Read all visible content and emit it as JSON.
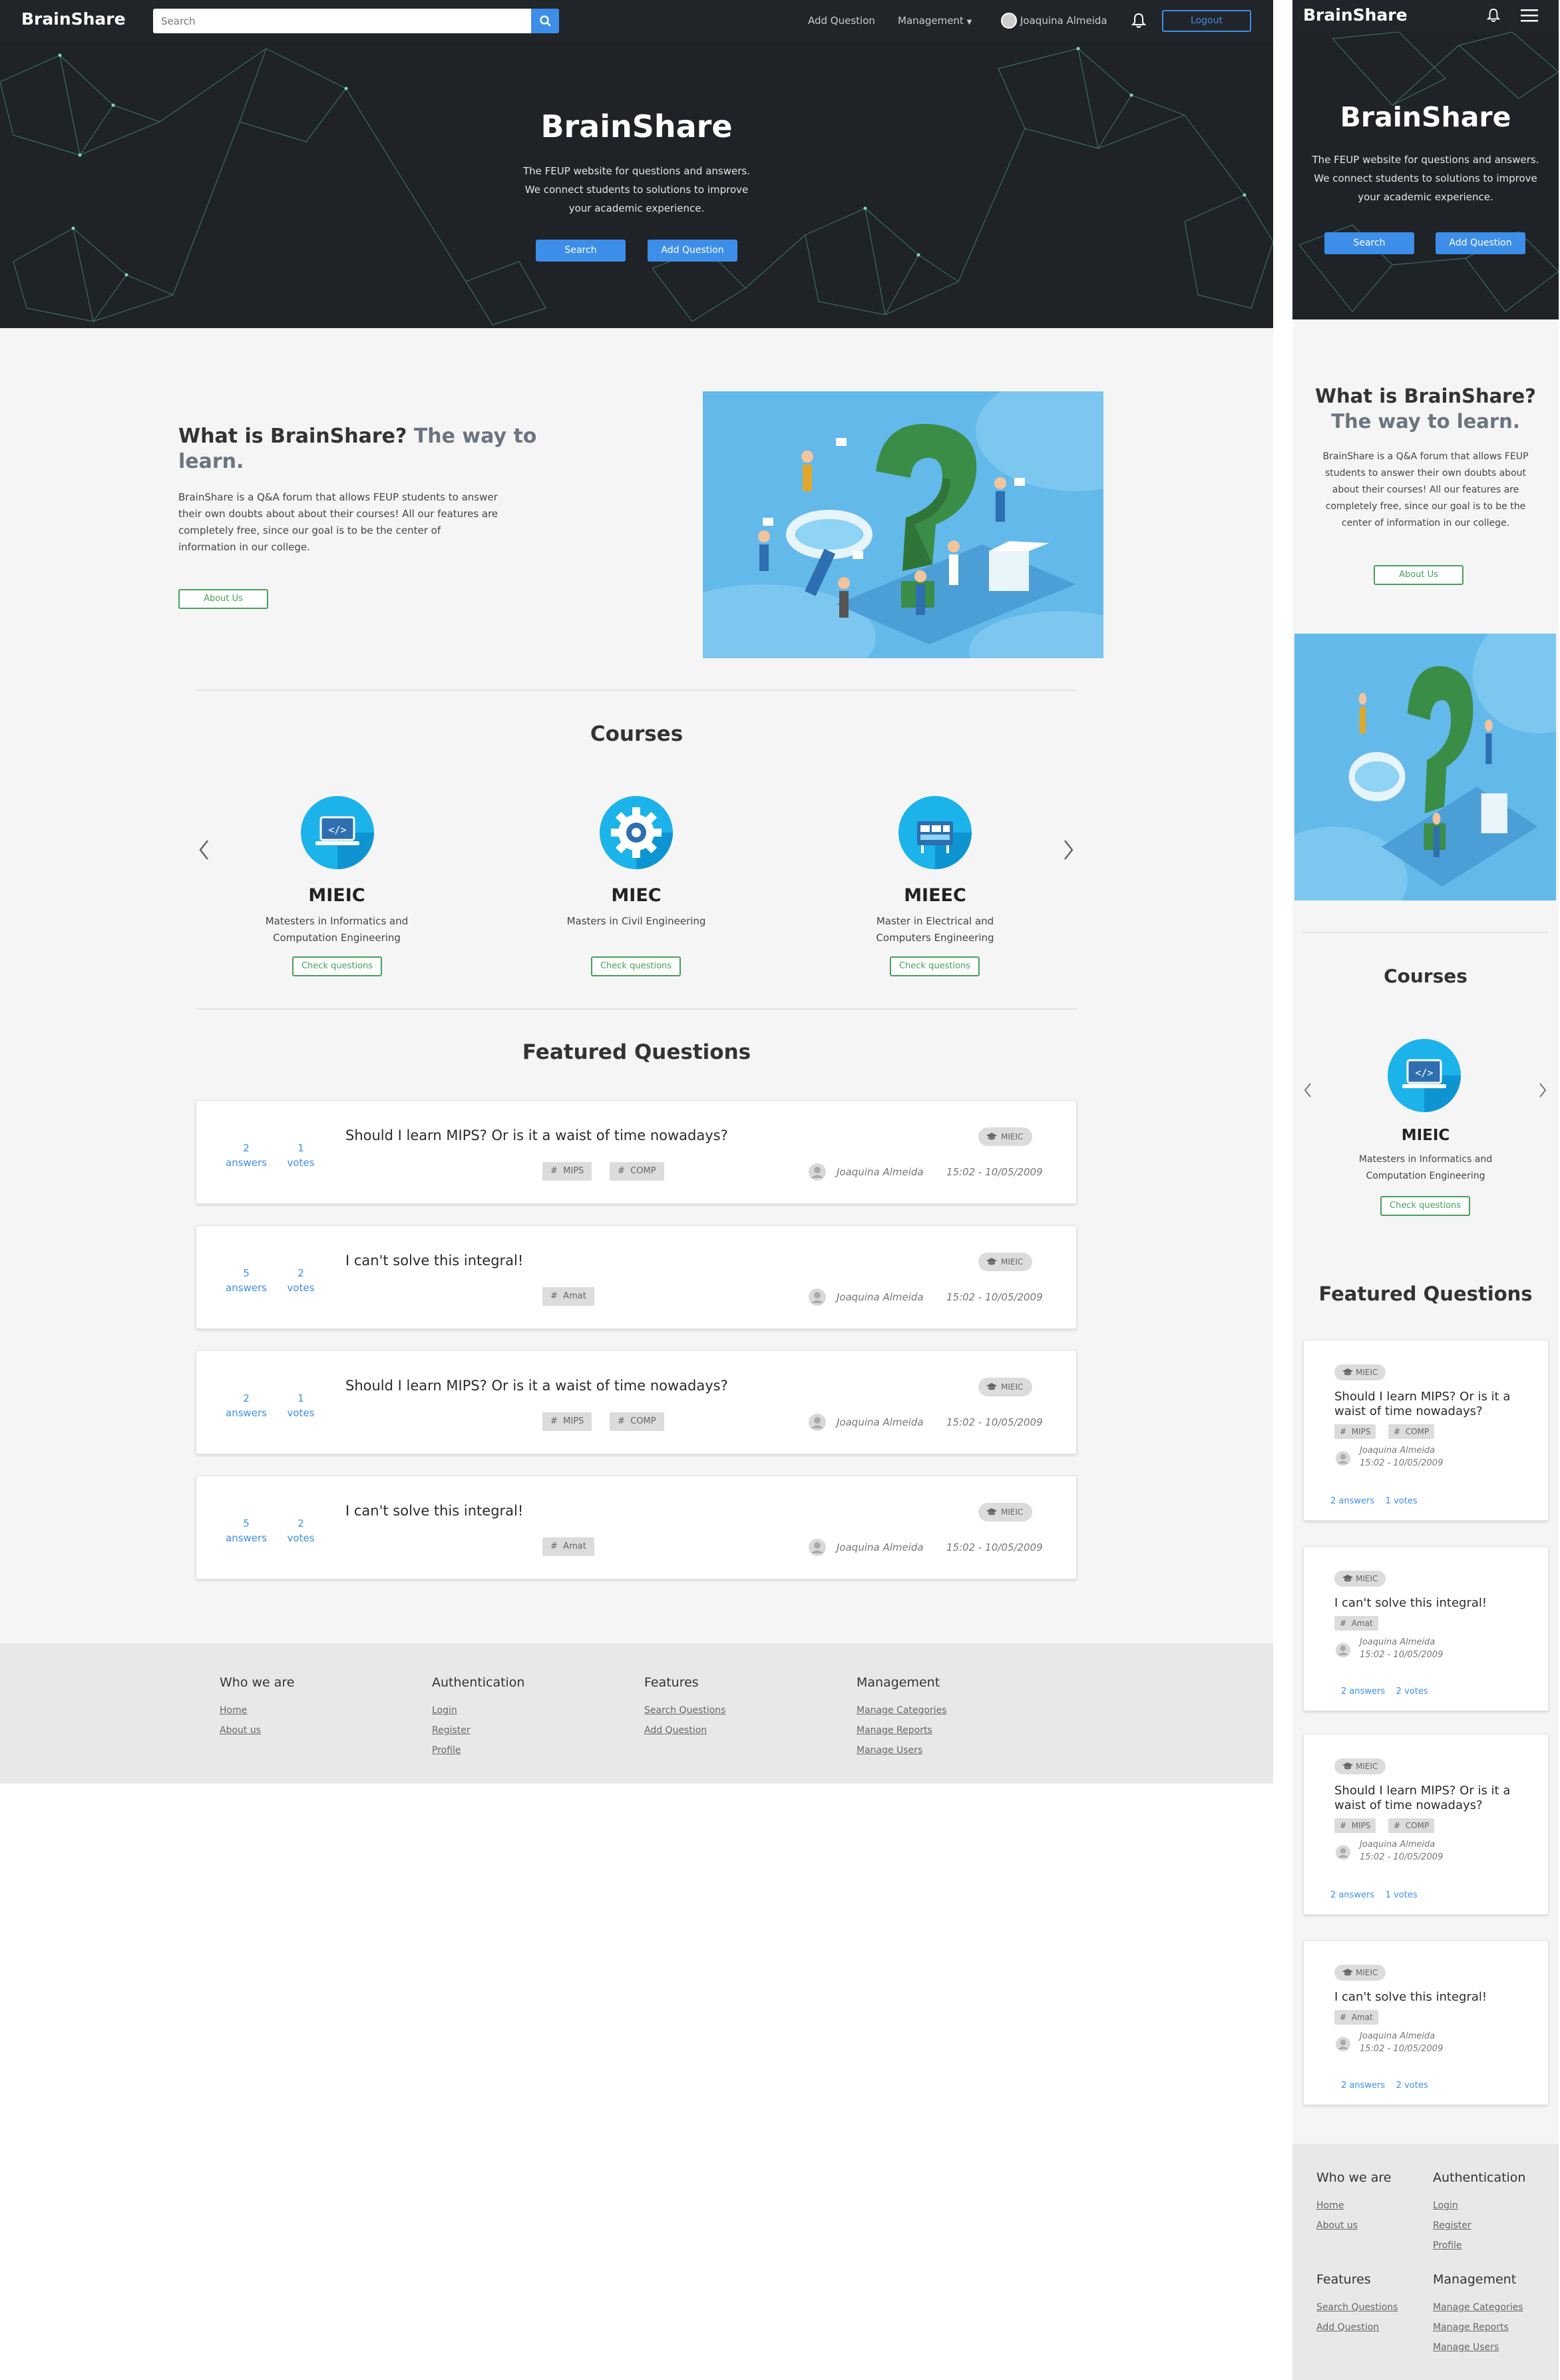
{
  "nav": {
    "brand": "BrainShare",
    "search_placeholder": "Search",
    "add_question": "Add Question",
    "management": "Management",
    "user_name": "Joaquina Almeida",
    "logout": "Logout"
  },
  "hero": {
    "title": "BrainShare",
    "description_lines": [
      "The FEUP website for questions and answers.",
      "We connect students to solutions to improve",
      "your academic experience."
    ],
    "search_button": "Search",
    "add_question_button": "Add Question"
  },
  "about": {
    "title": "What is BrainShare?",
    "subtitle": "The way to learn.",
    "desc_lines": [
      "BrainShare is a Q&A forum that allows FEUP students to answer",
      "their own doubts about about their courses! All our features are",
      "completely free, since our goal is to be the center of",
      "information in our college."
    ],
    "button": "About Us"
  },
  "courses": {
    "title": "Courses",
    "items": [
      {
        "name": "MIEIC",
        "desc_lines": [
          "Matesters in Informatics and",
          "Computation Engineering"
        ],
        "button": "Check questions",
        "icon": "computer-code-icon"
      },
      {
        "name": "MIEC",
        "desc_lines": [
          "Masters in Civil Engineering"
        ],
        "button": "Check questions",
        "icon": "gear-icon"
      },
      {
        "name": "MIEEC",
        "desc_lines": [
          "Master in Electrical and",
          "Computers Engineering"
        ],
        "button": "Check questions",
        "icon": "server-icon"
      }
    ]
  },
  "featured": {
    "title": "Featured Questions",
    "questions": [
      {
        "answers": "2",
        "answers_label": "answers",
        "votes": "1",
        "votes_label": "votes",
        "title": "Should I learn MIPS? Or is it a waist of time nowadays?",
        "tags": [
          "MIPS",
          "COMP"
        ],
        "course": "MIEIC",
        "author": "Joaquina Almeida",
        "date": "15:02 - 10/05/2009"
      },
      {
        "answers": "5",
        "answers_label": "answers",
        "votes": "2",
        "votes_label": "votes",
        "title": "I can't solve this integral!",
        "tags": [
          "Amat"
        ],
        "course": "MIEIC",
        "author": "Joaquina Almeida",
        "date": "15:02 - 10/05/2009"
      },
      {
        "answers": "2",
        "answers_label": "answers",
        "votes": "1",
        "votes_label": "votes",
        "title": "Should I learn MIPS? Or is it a waist of time nowadays?",
        "tags": [
          "MIPS",
          "COMP"
        ],
        "course": "MIEIC",
        "author": "Joaquina Almeida",
        "date": "15:02 - 10/05/2009"
      },
      {
        "answers": "5",
        "answers_label": "answers",
        "votes": "2",
        "votes_label": "votes",
        "title": "I can't solve this integral!",
        "tags": [
          "Amat"
        ],
        "course": "MIEIC",
        "author": "Joaquina Almeida",
        "date": "15:02 - 10/05/2009"
      }
    ]
  },
  "mobile": {
    "questions": [
      {
        "title_lines": [
          "Should I learn MIPS? Or is it a",
          "waist of time nowadays?"
        ],
        "answers": "2 answers",
        "votes": "1 votes"
      },
      {
        "title_lines": [
          "I can't solve this integral!"
        ],
        "answers": "2 answers",
        "votes": "2 votes"
      },
      {
        "title_lines": [
          "Should I learn MIPS? Or is it a",
          "waist of time nowadays?"
        ],
        "answers": "2 answers",
        "votes": "1 votes"
      },
      {
        "title_lines": [
          "I can't solve this integral!"
        ],
        "answers": "2 answers",
        "votes": "2 votes"
      }
    ],
    "about_lines": [
      "BrainShare is a Q&A forum that allows FEUP",
      "students to answer their own doubts about",
      "about their courses! All our features are",
      "completely free, since our goal is to be the",
      "center of information in our college."
    ]
  },
  "footer": {
    "columns": [
      {
        "title": "Who we are",
        "links": [
          "Home",
          "About us"
        ]
      },
      {
        "title": "Authentication",
        "links": [
          "Login",
          "Register",
          "Profile"
        ]
      },
      {
        "title": "Features",
        "links": [
          "Search Questions",
          "Add Question"
        ]
      },
      {
        "title": "Management",
        "links": [
          "Manage Categories",
          "Manage Reports",
          "Manage Users"
        ]
      }
    ]
  },
  "colors": {
    "accent": "#3d8ee8",
    "success": "#47a05b",
    "dark": "#212529"
  }
}
